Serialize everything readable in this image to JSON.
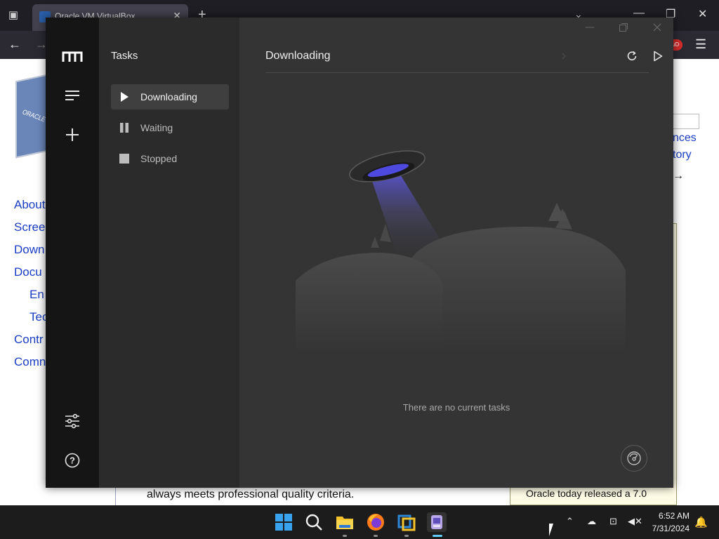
{
  "browser": {
    "tab_title": "Oracle VM VirtualBox",
    "tab_close": "✕",
    "new_tab": "+",
    "tab_list": "⌄",
    "minimize": "—",
    "restore": "❐",
    "close": "✕",
    "back": "←",
    "forward": "→",
    "menu": "☰",
    "extension_badge": "uD"
  },
  "page": {
    "logo_text": "ORACLE",
    "side_links": [
      "About",
      "Scree",
      "Down",
      "Docu",
      "En",
      "Tec",
      "Contr",
      "Comn"
    ],
    "right_links": [
      "nces",
      "tory"
    ],
    "arrow": "→",
    "body_text": "always meets professional quality criteria.",
    "news_text": "Oracle today released a 7.0"
  },
  "app": {
    "sidebar_title": "Tasks",
    "nav": [
      {
        "label": "Downloading",
        "icon": "play-icon",
        "active": true
      },
      {
        "label": "Waiting",
        "icon": "pause-icon",
        "active": false
      },
      {
        "label": "Stopped",
        "icon": "stop-icon",
        "active": false
      }
    ],
    "main_title": "Downloading",
    "empty_text": "There are no current tasks",
    "colors": {
      "rail": "#151515",
      "sidebar": "#2b2b2b",
      "main": "#343434",
      "ufo_beam": "#5a55d6"
    }
  },
  "taskbar": {
    "time": "6:52 AM",
    "date": "7/31/2024",
    "apps": [
      "windows-start-icon",
      "search-icon",
      "file-explorer-icon",
      "firefox-icon",
      "virtualbox-icon",
      "motrix-icon"
    ]
  }
}
